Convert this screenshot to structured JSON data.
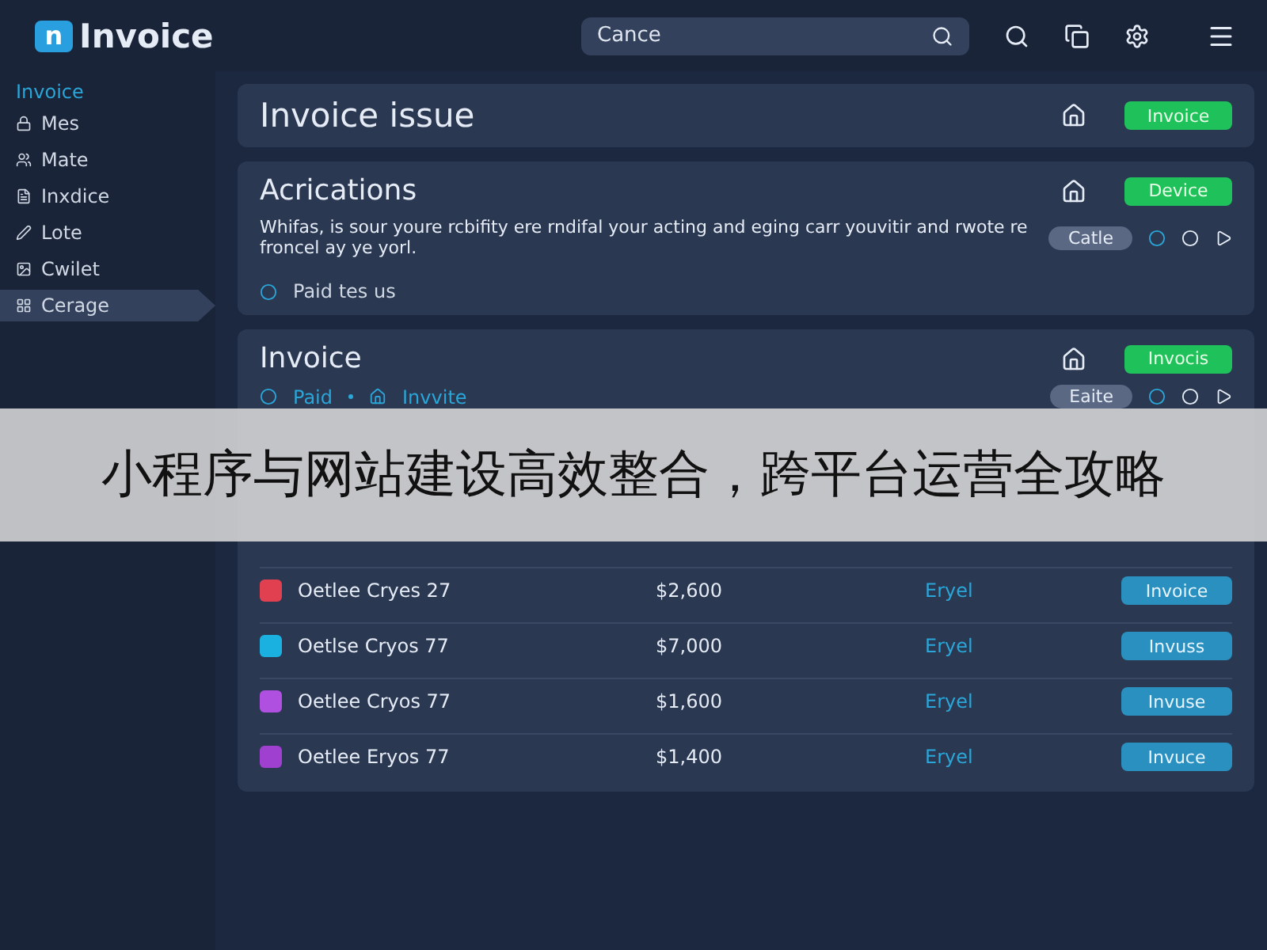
{
  "app": {
    "logo_letter": "n",
    "title": "Invoice"
  },
  "search": {
    "value": "Cance"
  },
  "sidebar": {
    "heading": "Invoice",
    "items": [
      {
        "label": "Mes",
        "selected": false
      },
      {
        "label": "Mate",
        "selected": false
      },
      {
        "label": "Inxdice",
        "selected": false
      },
      {
        "label": "Lote",
        "selected": false
      },
      {
        "label": "Cwilet",
        "selected": false
      },
      {
        "label": "Cerage",
        "selected": true
      }
    ]
  },
  "cards": [
    {
      "kind": "title",
      "title": "Invoice issue",
      "button": "Invoice"
    },
    {
      "kind": "text",
      "title": "Acrications",
      "button": "Device",
      "text": "Whifas, is sour youre rcbifity ere rndifal your acting and eging carr youvitir and rwote re froncel ay ye yorl.",
      "chip": "Catle",
      "link": "Paid tes us"
    },
    {
      "kind": "table",
      "title": "Invoice",
      "button": "Invocis",
      "filter_1": "Paid",
      "filter_2": "Invvite",
      "chip": "Eaite",
      "rows": [
        {
          "name": "Oetlee Cryes 27",
          "amount": "$2,600",
          "type": "Eryel",
          "action": "Invoice",
          "color": "#e04050"
        },
        {
          "name": "Oetlse Cryos 77",
          "amount": "$7,000",
          "type": "Eryel",
          "action": "Invuss",
          "color": "#1ab0e0"
        },
        {
          "name": "Oetlee Cryos 77",
          "amount": "$1,600",
          "type": "Eryel",
          "action": "Invuse",
          "color": "#b050e0"
        },
        {
          "name": "Oetlee Eryos 77",
          "amount": "$1,400",
          "type": "Eryel",
          "action": "Invuce",
          "color": "#a040d0"
        }
      ]
    }
  ],
  "banner": {
    "text": "小程序与网站建设高效整合，跨平台运营全攻略"
  }
}
